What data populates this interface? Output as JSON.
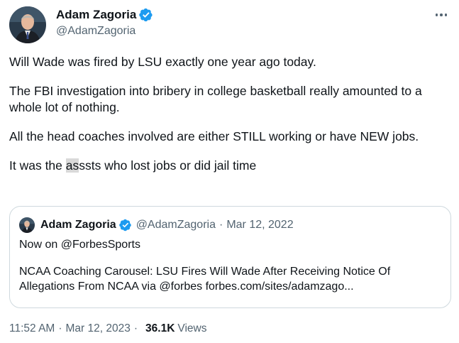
{
  "author": {
    "name": "Adam Zagoria",
    "handle": "@AdamZagoria"
  },
  "tweet": {
    "paragraphs": [
      "Will Wade was fired by LSU exactly one year ago today.",
      "The FBI investigation into bribery in college basketball really amounted to a whole lot of nothing.",
      "All the head coaches involved are either STILL working or have NEW jobs."
    ],
    "last_pre": "It was the ",
    "last_highlight": "as",
    "last_post": "ssts who lost jobs or did jail time"
  },
  "quote": {
    "name": "Adam Zagoria",
    "handle": "@AdamZagoria",
    "separator": "·",
    "date": "Mar 12, 2022",
    "line1": "Now on @ForbesSports",
    "line2": "NCAA Coaching Carousel: LSU Fires Will Wade After Receiving Notice Of Allegations From NCAA via @forbes forbes.com/sites/adamzago..."
  },
  "meta": {
    "time": "11:52 AM",
    "separator1": "·",
    "date": "Mar 12, 2023",
    "separator2": "·",
    "views_count": "36.1K",
    "views_label": "Views"
  },
  "icons": {
    "verified": "verified-badge-icon",
    "more": "more-options-icon"
  },
  "colors": {
    "verified_blue": "#1d9bf0",
    "secondary_text": "#536471",
    "primary_text": "#0f1419",
    "border": "#cfd9de",
    "highlight": "#d9d9d9"
  }
}
